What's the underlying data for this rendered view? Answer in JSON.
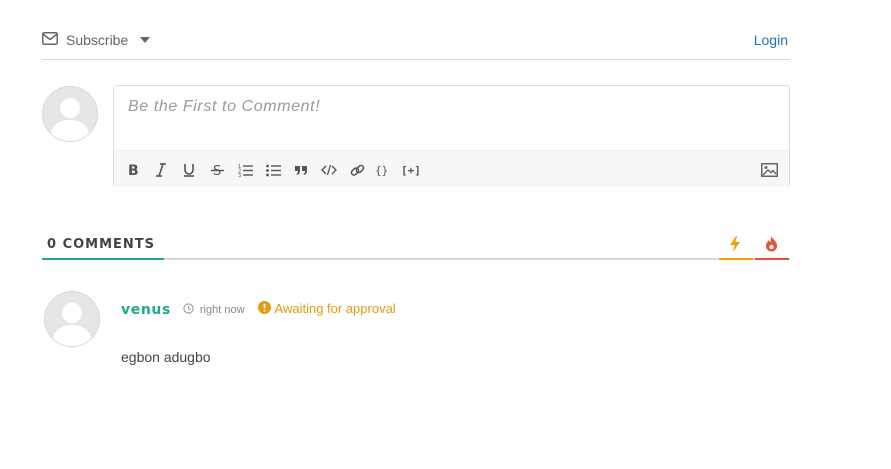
{
  "header": {
    "subscribe_label": "Subscribe",
    "login_label": "Login"
  },
  "editor": {
    "placeholder": "Be the First to Comment!",
    "toolbar": [
      {
        "name": "bold-icon",
        "glyph": "B"
      },
      {
        "name": "italic-icon",
        "glyph": "I"
      },
      {
        "name": "underline-icon",
        "glyph": "U"
      },
      {
        "name": "strikethrough-icon",
        "glyph": "S"
      },
      {
        "name": "ordered-list-icon",
        "glyph": ""
      },
      {
        "name": "bullet-list-icon",
        "glyph": ""
      },
      {
        "name": "blockquote-icon",
        "glyph": ""
      },
      {
        "name": "code-icon",
        "glyph": ""
      },
      {
        "name": "link-icon",
        "glyph": ""
      },
      {
        "name": "code-block-icon",
        "glyph": "{}"
      },
      {
        "name": "spoiler-icon",
        "glyph": "[+]"
      }
    ],
    "image_icon": "image-icon"
  },
  "tabs": {
    "count": "0",
    "label": "COMMENTS",
    "sort_newest_icon": "bolt-icon",
    "sort_hot_icon": "flame-icon"
  },
  "comment": {
    "author": "venus",
    "time": "right now",
    "status": "Awaiting for approval",
    "text": "egbon adugbo"
  },
  "colors": {
    "accent": "#1eaa8c",
    "link": "#1e73be",
    "warning": "#e69a0f",
    "hot": "#e55237"
  }
}
